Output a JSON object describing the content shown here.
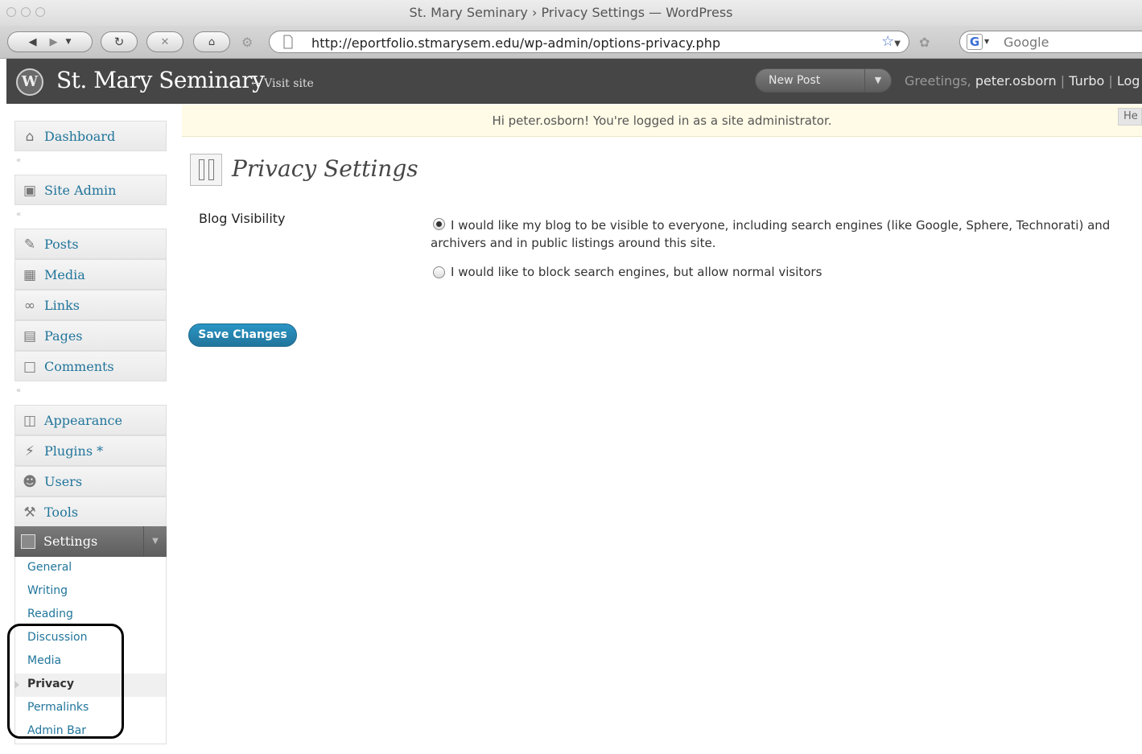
{
  "browser": {
    "window_title": "St. Mary Seminary › Privacy Settings — WordPress",
    "url": "http://eportfolio.stmarysem.edu/wp-admin/options-privacy.php",
    "search_placeholder": "Google",
    "search_engine_glyph": "G",
    "icons": [
      "back-icon",
      "forward-icon",
      "reload-icon",
      "stop-icon",
      "home-icon",
      "gear-icon",
      "page-icon",
      "bookmark-star-icon"
    ]
  },
  "header": {
    "logo_glyph": "W",
    "site_title": "St. Mary Seminary",
    "visit_site": "← Visit site",
    "new_post": "New Post",
    "greetings_prefix": "Greetings,",
    "username": "peter.osborn",
    "divider": "|",
    "turbo": "Turbo",
    "logout": "Log"
  },
  "notice": {
    "text": "Hi peter.osborn! You're logged in as a site administrator.",
    "help_tab": "He"
  },
  "sidebar": {
    "items": [
      {
        "label": "Dashboard",
        "icon": "dashboard-icon"
      },
      {
        "label": "Site Admin",
        "icon": "site-admin-icon"
      },
      {
        "label": "Posts",
        "icon": "posts-icon"
      },
      {
        "label": "Media",
        "icon": "media-icon"
      },
      {
        "label": "Links",
        "icon": "links-icon"
      },
      {
        "label": "Pages",
        "icon": "pages-icon"
      },
      {
        "label": "Comments",
        "icon": "comments-icon"
      },
      {
        "label": "Appearance",
        "icon": "appearance-icon"
      },
      {
        "label": "Plugins *",
        "icon": "plugins-icon"
      },
      {
        "label": "Users",
        "icon": "users-icon"
      },
      {
        "label": "Tools",
        "icon": "tools-icon"
      }
    ],
    "settings": {
      "label": "Settings",
      "icon": "settings-icon"
    },
    "submenu": [
      "General",
      "Writing",
      "Reading",
      "Discussion",
      "Media",
      "Privacy",
      "Permalinks",
      "Admin Bar"
    ],
    "current_submenu": "Privacy"
  },
  "main": {
    "page_title": "Privacy Settings",
    "field_label": "Blog Visibility",
    "options": [
      {
        "label": "I would like my blog to be visible to everyone, including search engines (like Google, Sphere, Technorati) and archivers and in public listings around this site.",
        "checked": true
      },
      {
        "label": "I would like to block search engines, but allow normal visitors",
        "checked": false
      }
    ],
    "save_button": "Save Changes"
  },
  "colors": {
    "link_blue": "#21759b",
    "header_bg": "#464646",
    "notice_bg": "#fffbe6",
    "button_blue": "#21759b"
  }
}
